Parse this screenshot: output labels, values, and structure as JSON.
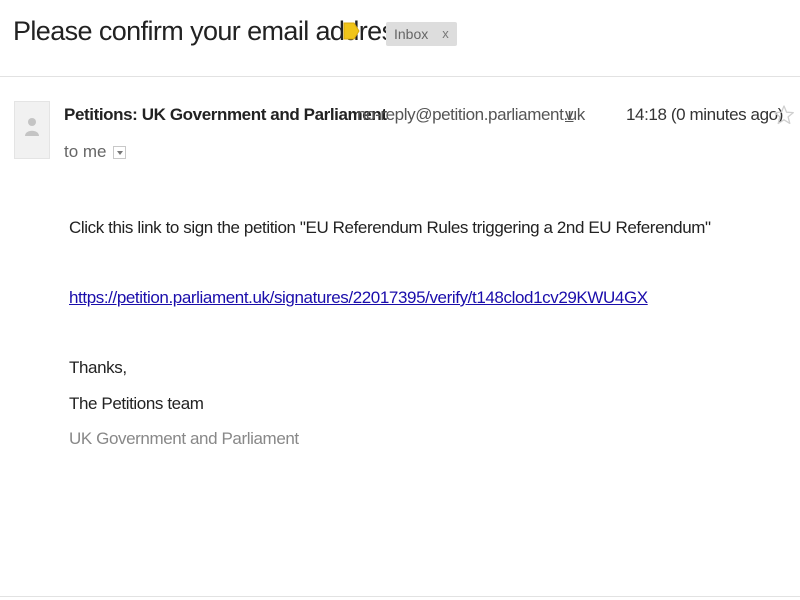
{
  "header": {
    "subject": "Please confirm your email address",
    "importance_color": "#f0c419",
    "label": "Inbox",
    "label_remove": "x"
  },
  "message": {
    "sender_name": "Petitions: UK Government and Parliament",
    "sender_email": "no-reply@petition.parliament.uk",
    "sender_details_glyph": "v",
    "timestamp": "14:18 (0 minutes ago)",
    "recipients": "to me",
    "icons": {
      "avatar": "default-avatar-icon",
      "star": "star-outline-icon",
      "importance": "importance-marker-icon",
      "recipients_toggle": "dropdown-arrow-icon"
    }
  },
  "body": {
    "intro": "Click this link to sign the petition \"EU Referendum Rules triggering a 2nd EU Referendum\"",
    "link": "https://petition.parliament.uk/signatures/22017395/verify/t148clod1cv29KWU4GX",
    "signoff": "Thanks,",
    "team": "The Petitions team",
    "organisation": "UK Government and Parliament"
  },
  "colors": {
    "link": "#1a0dab",
    "muted": "#888888"
  }
}
